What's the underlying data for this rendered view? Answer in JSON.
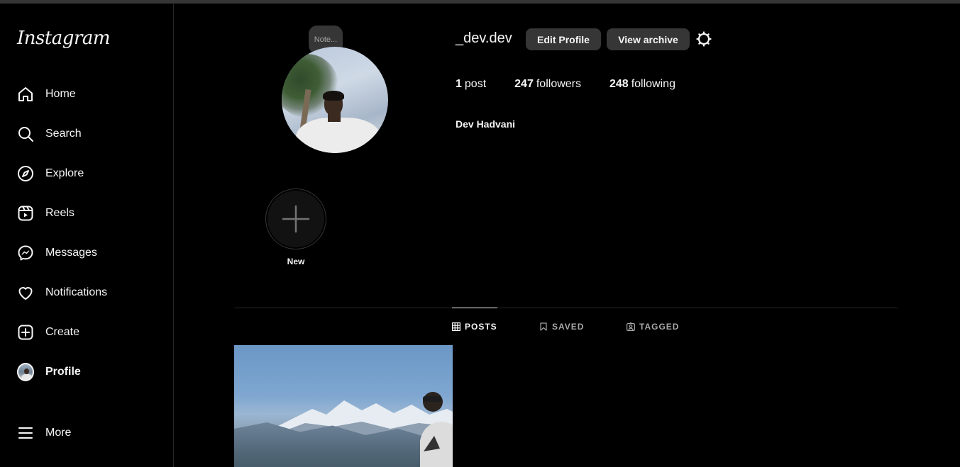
{
  "sidebar": {
    "logo": "Instagram",
    "items": [
      {
        "label": "Home",
        "icon": "home-icon"
      },
      {
        "label": "Search",
        "icon": "search-icon"
      },
      {
        "label": "Explore",
        "icon": "compass-icon"
      },
      {
        "label": "Reels",
        "icon": "reels-icon"
      },
      {
        "label": "Messages",
        "icon": "messenger-icon"
      },
      {
        "label": "Notifications",
        "icon": "heart-icon"
      },
      {
        "label": "Create",
        "icon": "plus-square-icon"
      },
      {
        "label": "Profile",
        "icon": "avatar"
      },
      {
        "label": "More",
        "icon": "menu-icon"
      }
    ]
  },
  "profile": {
    "note_placeholder": "Note...",
    "username": "_dev.dev",
    "edit_label": "Edit Profile",
    "archive_label": "View archive",
    "stats": {
      "posts_count": "1",
      "posts_label": "post",
      "followers_count": "247",
      "followers_label": "followers",
      "following_count": "248",
      "following_label": "following"
    },
    "full_name": "Dev Hadvani",
    "new_highlight_label": "New"
  },
  "tabs": [
    {
      "label": "POSTS",
      "icon": "grid-icon",
      "active": true
    },
    {
      "label": "SAVED",
      "icon": "bookmark-icon",
      "active": false
    },
    {
      "label": "TAGGED",
      "icon": "tag-user-icon",
      "active": false
    }
  ],
  "colors": {
    "background": "#000000",
    "text": "#f5f5f5",
    "button_bg": "#363636",
    "muted": "#a8a8a8"
  }
}
